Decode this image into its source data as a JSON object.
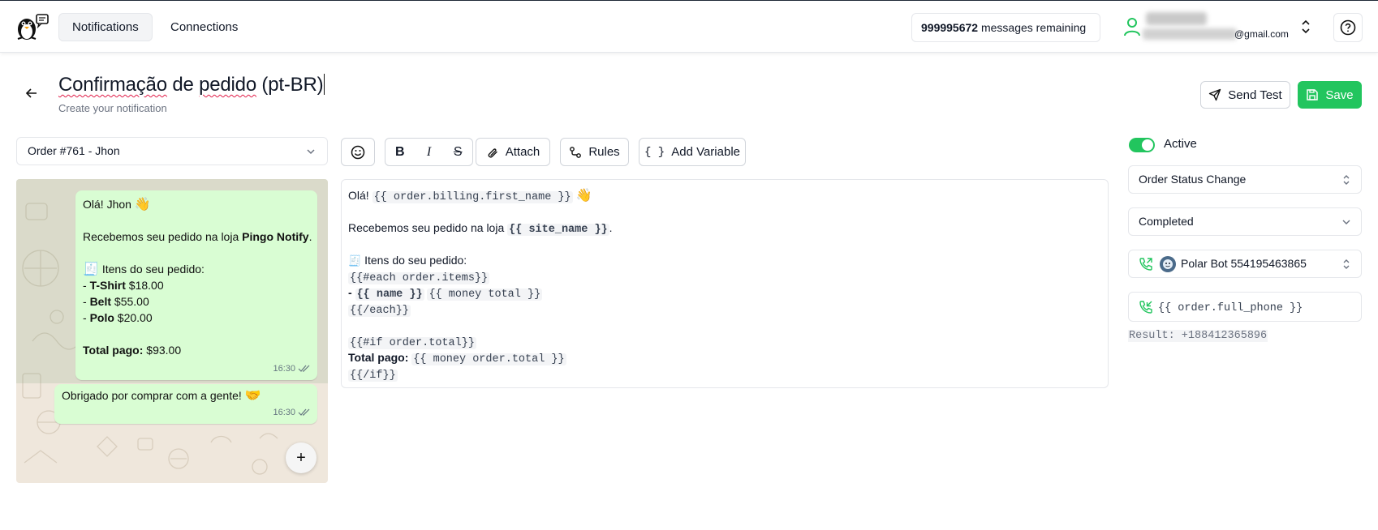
{
  "header": {
    "nav": [
      "Notifications",
      "Connections"
    ],
    "messages_count": "999995672",
    "messages_label": "messages remaining",
    "user_email_suffix": "@gmail.com"
  },
  "page": {
    "title_part1": "Confirmação",
    "title_part2": " de ",
    "title_part3": "pedido",
    "title_part4": " (pt-BR)",
    "subtitle": "Create your notification",
    "send_test_label": "Send Test",
    "save_label": "Save"
  },
  "order_select": {
    "value": "Order #761 - Jhon"
  },
  "toolbar": {
    "bold": "B",
    "italic": "I",
    "strike": "S",
    "attach_label": "Attach",
    "rules_label": "Rules",
    "variable_label": "Add Variable"
  },
  "preview": {
    "greeting": "Olá! Jhon",
    "received_prefix": "Recebemos seu pedido na loja ",
    "store": "Pingo Notify",
    "received_suffix": ".",
    "items_header": "Itens do seu pedido:",
    "items": [
      {
        "name": "T-Shirt",
        "price": "$18.00"
      },
      {
        "name": "Belt",
        "price": "$55.00"
      },
      {
        "name": "Polo",
        "price": "$20.00"
      }
    ],
    "total_label": "Total pago:",
    "total_value": "$93.00",
    "time1": "16:30",
    "thanks": "Obrigado por comprar com a gente!",
    "time2": "16:30",
    "fab": "+"
  },
  "editor": {
    "l1_text": "Olá! ",
    "l1_code": "{{ order.billing.first_name }}",
    "l2_text": "Recebemos seu pedido na loja ",
    "l2_code": "{{ site_name }}",
    "l2_suffix": ".",
    "l3_text": "Itens do seu pedido:",
    "l4_code": "{{#each order.items}}",
    "l5_prefix": "- ",
    "l5_code1": "{{ name }}",
    "l5_code2": "{{ money total }}",
    "l6_code": "{{/each}}",
    "l7_code": "{{#if order.total}}",
    "l8_text": "Total pago: ",
    "l8_code": "{{ money order.total }}",
    "l9_code": "{{/if}}"
  },
  "right_panel": {
    "active_label": "Active",
    "trigger": "Order Status Change",
    "status": "Completed",
    "bot": "Polar Bot 554195463865",
    "phone_template": "{{ order.full_phone }}",
    "result": "Result: +188412365896"
  },
  "colors": {
    "accent": "#22c55e",
    "bubble": "#d9fdd3",
    "chat_bg": "#efe7dc"
  },
  "icons": [
    "penguin-logo-icon",
    "user-icon",
    "chevrons-updown-icon",
    "help-icon",
    "arrow-left-icon",
    "send-icon",
    "save-icon",
    "chevron-down-icon",
    "emoji-icon",
    "paperclip-icon",
    "rules-icon",
    "braces-icon",
    "phone-outgoing-icon",
    "phone-incoming-icon",
    "double-check-icon",
    "plus-icon"
  ]
}
